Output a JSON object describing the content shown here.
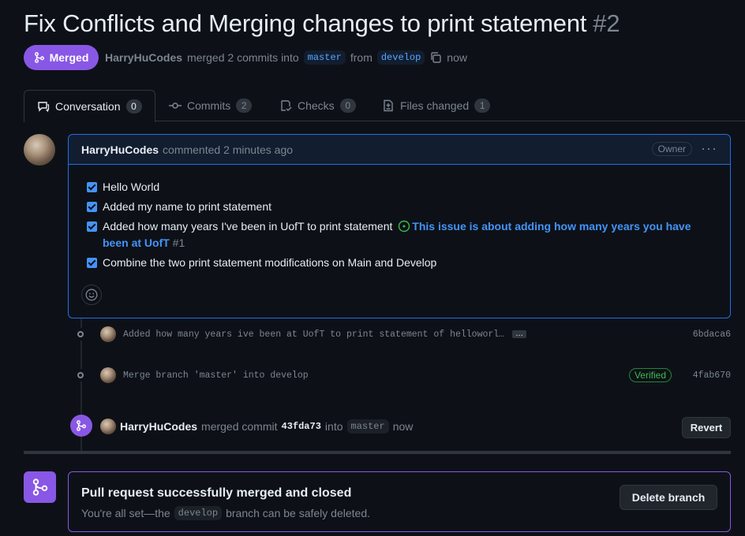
{
  "pr": {
    "title": "Fix Conflicts and Merging changes to print statement",
    "number": "#2",
    "status": "Merged",
    "author": "HarryHuCodes",
    "action": "merged 2 commits into",
    "base_branch": "master",
    "from_label": "from",
    "head_branch": "develop",
    "time": "now"
  },
  "tabs": [
    {
      "label": "Conversation",
      "count": "0"
    },
    {
      "label": "Commits",
      "count": "2"
    },
    {
      "label": "Checks",
      "count": "0"
    },
    {
      "label": "Files changed",
      "count": "1"
    }
  ],
  "comment": {
    "author": "HarryHuCodes",
    "meta": "commented 2 minutes ago",
    "role": "Owner",
    "tasks": [
      {
        "text": "Hello World"
      },
      {
        "text": "Added my name to print statement"
      },
      {
        "text": "Added how many years I've been in UofT to print statement",
        "issue_title": "This issue is about adding how many years you have been at UofT",
        "issue_number": "#1"
      },
      {
        "text": "Combine the two print statement modifications on Main and Develop"
      }
    ]
  },
  "commits": [
    {
      "message": "Added how many years ive been at UofT to print statement of helloworl…",
      "sha": "6bdaca6",
      "ellipsis": "…"
    },
    {
      "message": "Merge branch 'master' into develop",
      "sha": "4fab670",
      "badge": "Verified"
    }
  ],
  "merge_event": {
    "author": "HarryHuCodes",
    "text": "merged commit",
    "sha": "43fda73",
    "into": "into",
    "branch": "master",
    "time": "now",
    "revert_label": "Revert"
  },
  "merged_box": {
    "title": "Pull request successfully merged and closed",
    "sub_before": "You're all set—the",
    "branch": "develop",
    "sub_after": "branch can be safely deleted.",
    "delete_label": "Delete branch"
  },
  "colors": {
    "merged": "#8957e5",
    "accent": "#4493f8",
    "verified": "#3fb950",
    "background": "#0d1117"
  }
}
